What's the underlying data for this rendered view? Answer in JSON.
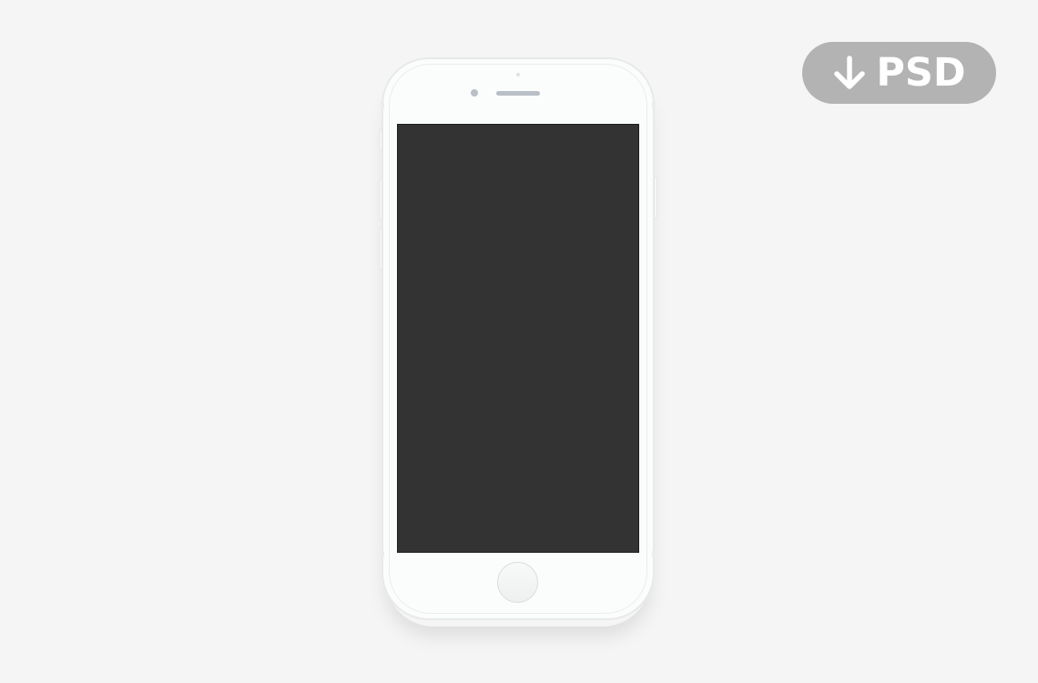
{
  "download": {
    "label": "PSD",
    "icon": "arrow-down-icon",
    "background_color": "#b3b3b3",
    "text_color": "#ffffff"
  },
  "mockup": {
    "device": "phone",
    "body_color": "#fbfcfc",
    "screen_color": "#333333",
    "background_color": "#f5f5f5"
  }
}
